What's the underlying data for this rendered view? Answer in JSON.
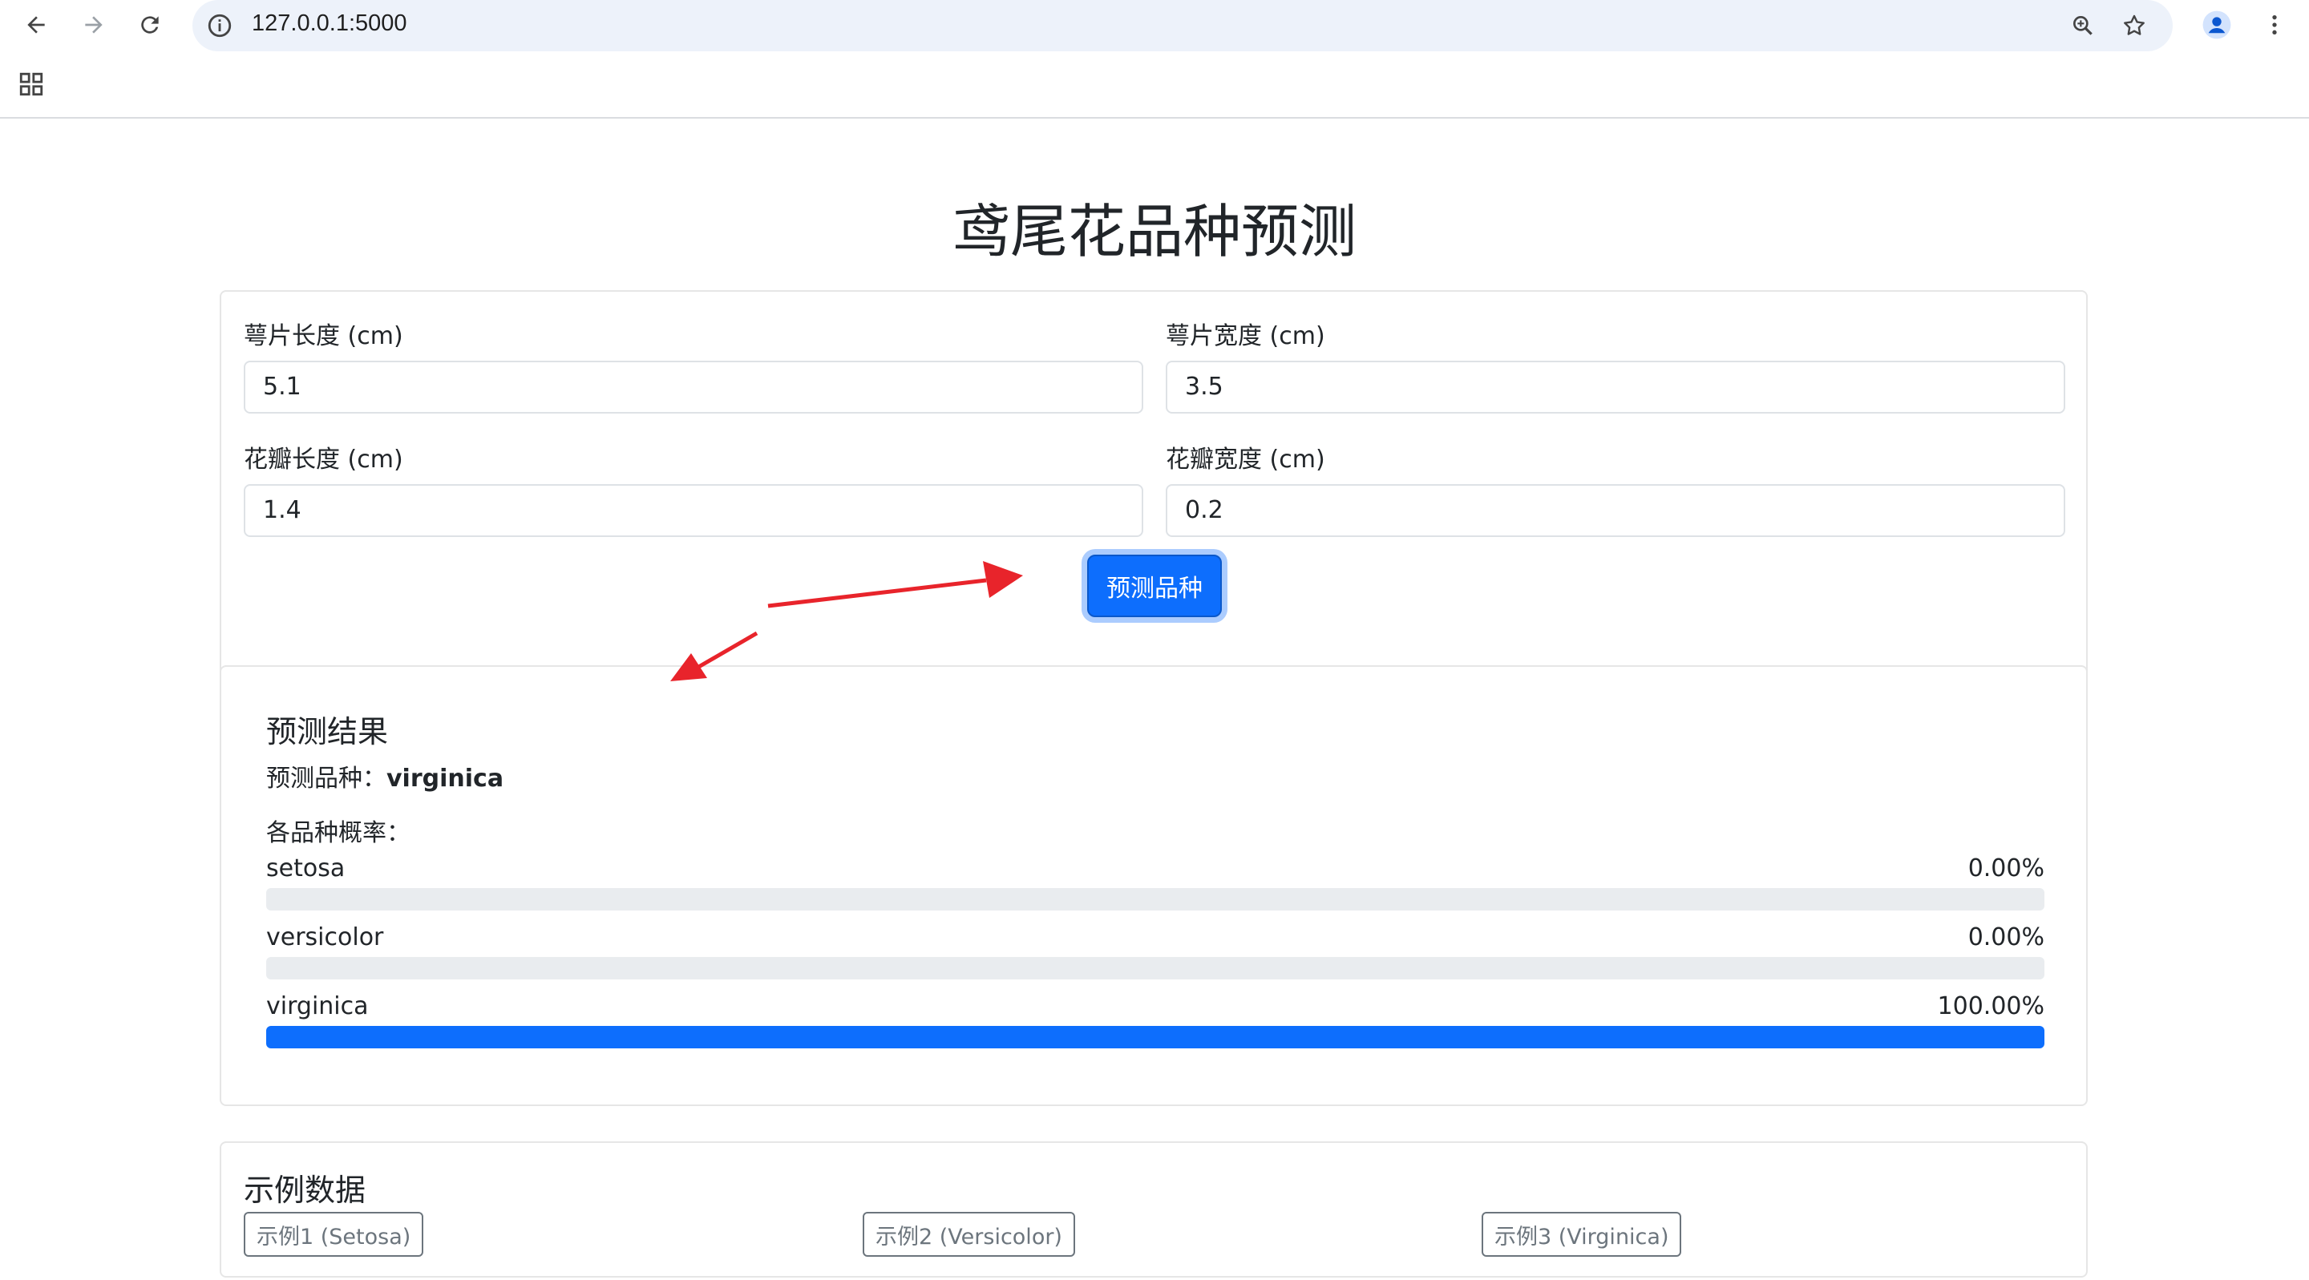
{
  "browser": {
    "url": "127.0.0.1:5000",
    "icons": [
      "back-arrow-icon",
      "forward-arrow-icon",
      "reload-icon",
      "site-info-icon",
      "zoom-icon",
      "bookmark-star-icon",
      "profile-icon",
      "more-menu-icon",
      "apps-grid-icon"
    ]
  },
  "page": {
    "title": "鸢尾花品种预测",
    "form": {
      "sepal_length": {
        "label": "萼片长度 (cm)",
        "value": "5.1"
      },
      "sepal_width": {
        "label": "萼片宽度 (cm)",
        "value": "3.5"
      },
      "petal_length": {
        "label": "花瓣长度 (cm)",
        "value": "1.4"
      },
      "petal_width": {
        "label": "花瓣宽度 (cm)",
        "value": "0.2"
      },
      "submit_label": "预测品种"
    },
    "result": {
      "title": "预测结果",
      "predicted_prefix": "预测品种：",
      "predicted_value": "virginica",
      "probabilities_heading": "各品种概率：",
      "probabilities": [
        {
          "name": "setosa",
          "value_text": "0.00%",
          "value": 0.0
        },
        {
          "name": "versicolor",
          "value_text": "0.00%",
          "value": 0.0
        },
        {
          "name": "virginica",
          "value_text": "100.00%",
          "value": 1.0
        }
      ]
    },
    "examples": {
      "title": "示例数据",
      "buttons": [
        "示例1 (Setosa)",
        "示例2 (Versicolor)",
        "示例3 (Virginica)"
      ]
    }
  },
  "colors": {
    "primary": "#0d6efd",
    "track": "#e9ecef",
    "annotation_arrow": "#e8242b",
    "omnibox": "#edf2fa"
  }
}
